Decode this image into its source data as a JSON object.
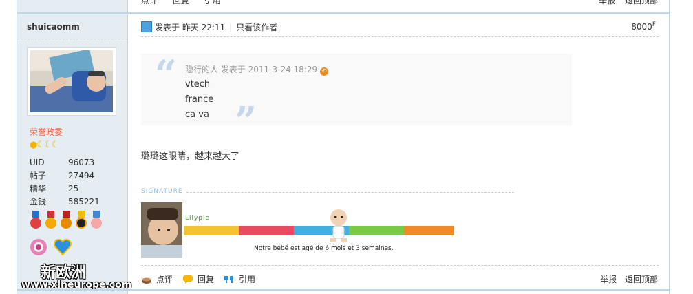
{
  "previous_post": {
    "actions": [
      "点评",
      "回复",
      "引用"
    ],
    "right_links": [
      "举报",
      "返回顶部"
    ]
  },
  "author": {
    "name": "shuicaomm",
    "group": "荣誉政委",
    "stats": [
      {
        "label": "UID",
        "value": "96073"
      },
      {
        "label": "帖子",
        "value": "27494"
      },
      {
        "label": "精华",
        "value": "25"
      },
      {
        "label": "金钱",
        "value": "585221"
      }
    ]
  },
  "post": {
    "posted": "发表于 昨天 22:11",
    "only_author": "只看该作者",
    "floor": "8000",
    "floor_sup": "F",
    "quote": {
      "header": "隐行的人 发表于 2011-3-24 18:29",
      "lines": [
        "vtech",
        "france",
        "ca va"
      ]
    },
    "message": "璐璐这眼睛，越来越大了",
    "signature_label": "SIGNATURE",
    "signature": {
      "lilypie": "Lilypie",
      "ticker": "Notre bébé est agé de 6 mois et 3 semaines."
    },
    "actions": [
      "点评",
      "回复",
      "引用"
    ],
    "right_links": [
      "举报",
      "返回顶部"
    ]
  },
  "watermark": {
    "line1": "新欧洲",
    "line2": "www.xineurope.com"
  },
  "colors": {
    "sidebar_bg": "#e5edf2",
    "border": "#c2d5e3",
    "group_color": "#f26c4f",
    "quote_mark": "#c5d8ea",
    "signature_label": "#8ec0e2"
  }
}
